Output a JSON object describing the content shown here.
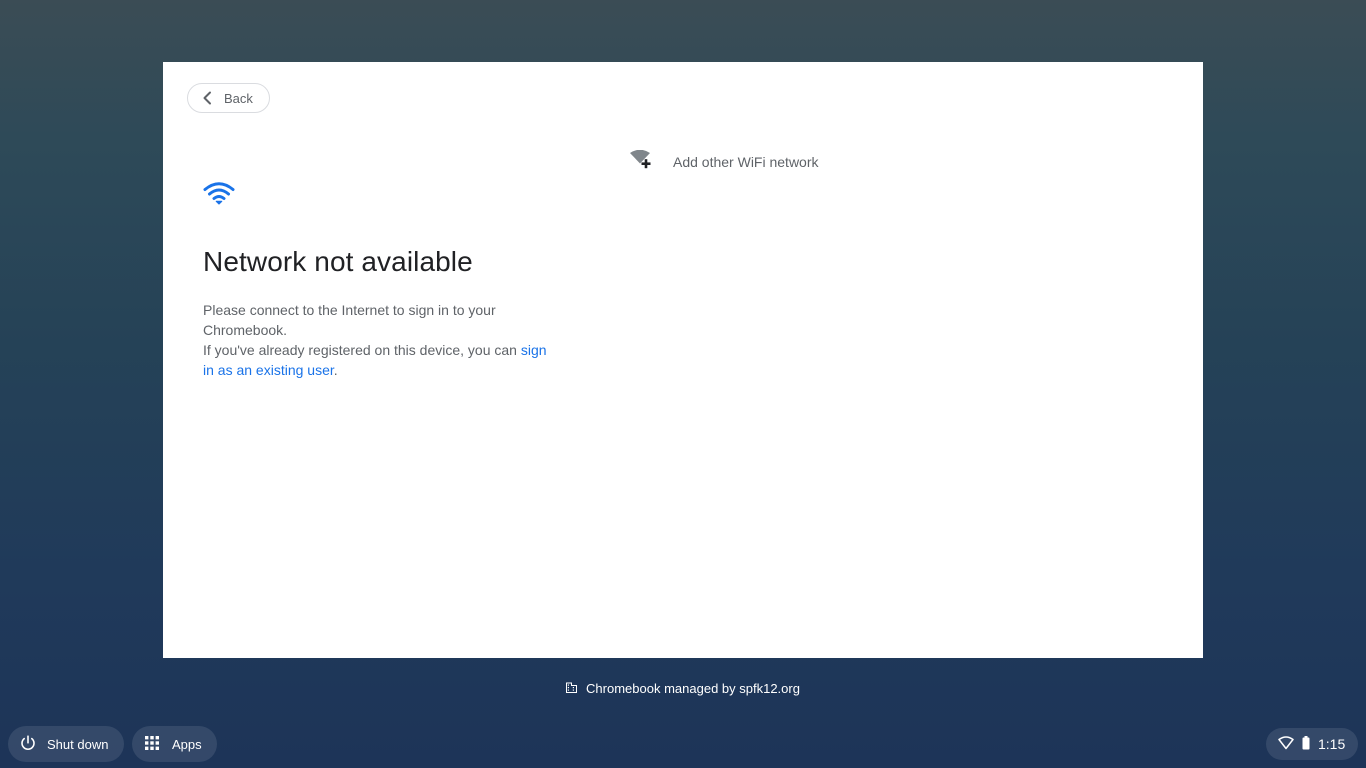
{
  "dialog": {
    "back_label": "Back",
    "title": "Network not available",
    "description_line1": "Please connect to the Internet to sign in to your Chromebook.",
    "description_line2_prefix": "If you've already registered on this device, you can ",
    "description_line2_link": "sign in as an existing user",
    "description_line2_suffix": ".",
    "add_network_label": "Add other WiFi network",
    "accent_color": "#1a73e8",
    "icons": {
      "back": "chevron-left-icon",
      "wifi": "wifi-icon",
      "add_network": "wifi-add-icon"
    }
  },
  "footer": {
    "managed_text": "Chromebook managed by spfk12.org",
    "icon": "building-icon"
  },
  "shelf": {
    "shutdown_label": "Shut down",
    "apps_label": "Apps",
    "time": "1:15",
    "icons": {
      "shutdown": "power-icon",
      "apps": "grid-icon",
      "network": "wifi-status-icon",
      "battery": "battery-icon"
    }
  }
}
